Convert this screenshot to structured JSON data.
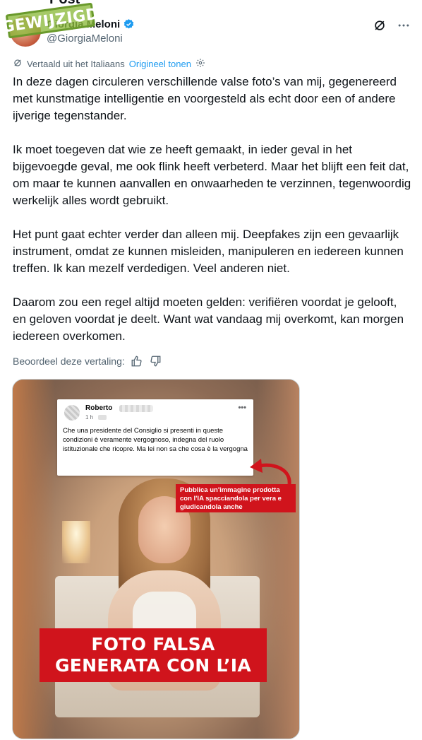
{
  "page": {
    "top_cut_title": "Post"
  },
  "stamp": {
    "text": "GEWIJZIGD"
  },
  "author": {
    "display_name": "Giorgia Meloni",
    "handle": "@GiorgiaMeloni",
    "avatar_icon": "profile-photo-avatar",
    "verified_icon": "verified-badge-icon",
    "verified_color": "#1d9bf0"
  },
  "header_actions": {
    "grok_icon": "grok-icon",
    "more_icon": "more-dots-icon"
  },
  "translation": {
    "label": "Vertaald uit het Italiaans",
    "original_link": "Origineel tonen",
    "settings_icon": "gear-icon"
  },
  "tweet": {
    "paragraphs": [
      "In deze dagen circuleren verschillende valse foto’s van mij, gegenereerd met kunstmatige intelligentie en voorgesteld als echt door een of andere ijverige tegenstander.",
      "Ik moet toegeven dat wie ze heeft gemaakt, in ieder geval in het bijgevoegde geval, me ook flink heeft verbeterd. Maar het blijft een feit dat, om maar te kunnen aanvallen en onwaarheden te verzinnen, tegenwoordig werkelijk alles wordt gebruikt.",
      "Het punt gaat echter verder dan alleen mij. Deepfakes zijn een gevaarlijk instrument, omdat ze kunnen misleiden, manipuleren en iedereen kunnen treffen. Ik kan mezelf verdedigen. Veel anderen niet.",
      "Daarom zou een regel altijd moeten gelden: verifiëren voordat je gelooft, en geloven voordat je deelt. Want wat vandaag mij overkomt, kan morgen iedereen overkomen."
    ]
  },
  "rating": {
    "label": "Beoordeel deze vertaling:",
    "thumbs_up_icon": "thumbs-up-icon",
    "thumbs_down_icon": "thumbs-down-icon"
  },
  "media": {
    "fb_post": {
      "name": "Roberto",
      "time": "1 h",
      "more": "•••",
      "text": "Che una presidente del Consiglio  si presenti in queste condizioni è veramente vergognoso, indegna del ruolo istituzionale che ricopre. Ma lei non sa che cosa è la vergogna"
    },
    "red_note": "Pubblica un'immagine prodotta con l'IA spacciandola per vera e giudicandola anche",
    "banner_line1": "FOTO FALSA",
    "banner_line2": "GENERATA CON L’IA",
    "accent_red": "#d0141c"
  }
}
